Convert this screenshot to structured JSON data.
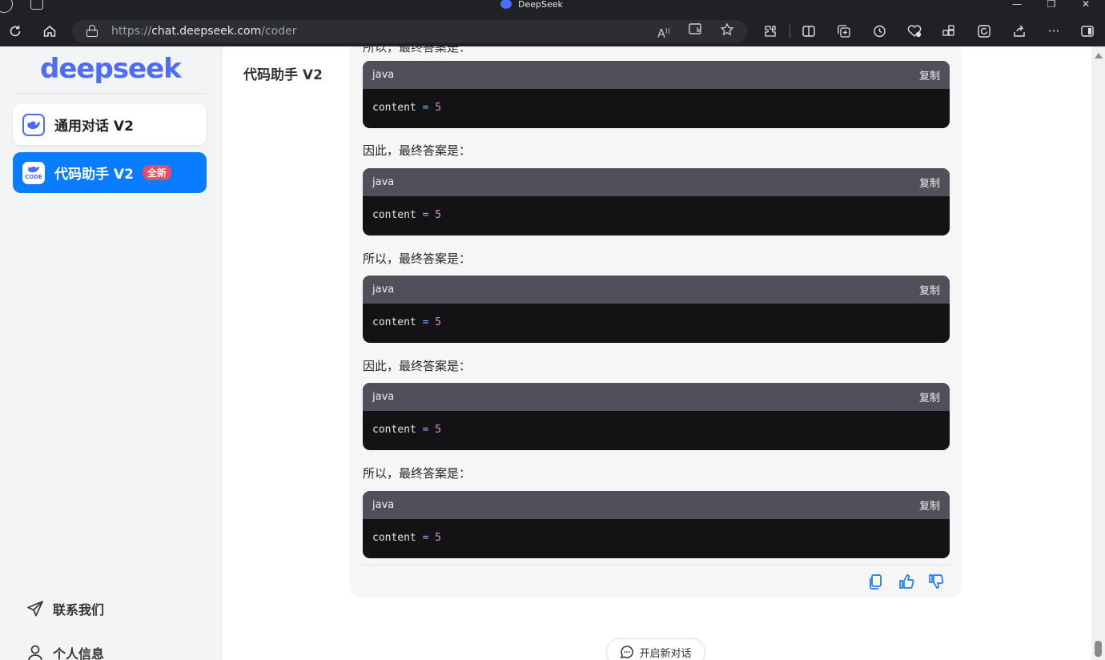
{
  "browser": {
    "window_title": "DeepSeek",
    "url_protocol": "https://",
    "url_host": "chat.deepseek.com",
    "url_path": "/coder",
    "window_controls": {
      "minimize": "—",
      "maximize": "❐",
      "close": "✕"
    }
  },
  "sidebar": {
    "brand": "deepseek",
    "items": [
      {
        "label": "通用对话 V2",
        "icon": "whale-icon",
        "active": false
      },
      {
        "label": "代码助手 V2",
        "icon": "code-whale-icon",
        "active": true,
        "badge": "全新",
        "icon_text": "CODE"
      }
    ],
    "bottom_links": [
      {
        "label": "联系我们",
        "icon": "send-icon"
      },
      {
        "label": "个人信息",
        "icon": "user-icon"
      }
    ]
  },
  "main": {
    "title": "代码助手 V2",
    "cut_text": "所以，最终答案是：",
    "messages": [
      {
        "type": "code",
        "lang": "java",
        "copy": "复制",
        "tokens": [
          "content",
          "=",
          "5"
        ]
      },
      {
        "type": "text",
        "text": "因此，最终答案是："
      },
      {
        "type": "code",
        "lang": "java",
        "copy": "复制",
        "tokens": [
          "content",
          "=",
          "5"
        ]
      },
      {
        "type": "text",
        "text": "所以，最终答案是："
      },
      {
        "type": "code",
        "lang": "java",
        "copy": "复制",
        "tokens": [
          "content",
          "=",
          "5"
        ]
      },
      {
        "type": "text",
        "text": "因此，最终答案是："
      },
      {
        "type": "code",
        "lang": "java",
        "copy": "复制",
        "tokens": [
          "content",
          "=",
          "5"
        ]
      },
      {
        "type": "text",
        "text": "所以，最终答案是："
      },
      {
        "type": "code",
        "lang": "java",
        "copy": "复制",
        "tokens": [
          "content",
          "=",
          "5"
        ]
      }
    ],
    "actions": [
      "copy-icon",
      "thumbs-up-icon",
      "thumbs-down-icon"
    ],
    "new_chat_label": "开启新对话"
  },
  "colors": {
    "accent": "#4d6bfe",
    "active_nav": "#0a7cff",
    "badge": "#f04a5e",
    "code_header": "#50505a",
    "code_body": "#131316"
  }
}
